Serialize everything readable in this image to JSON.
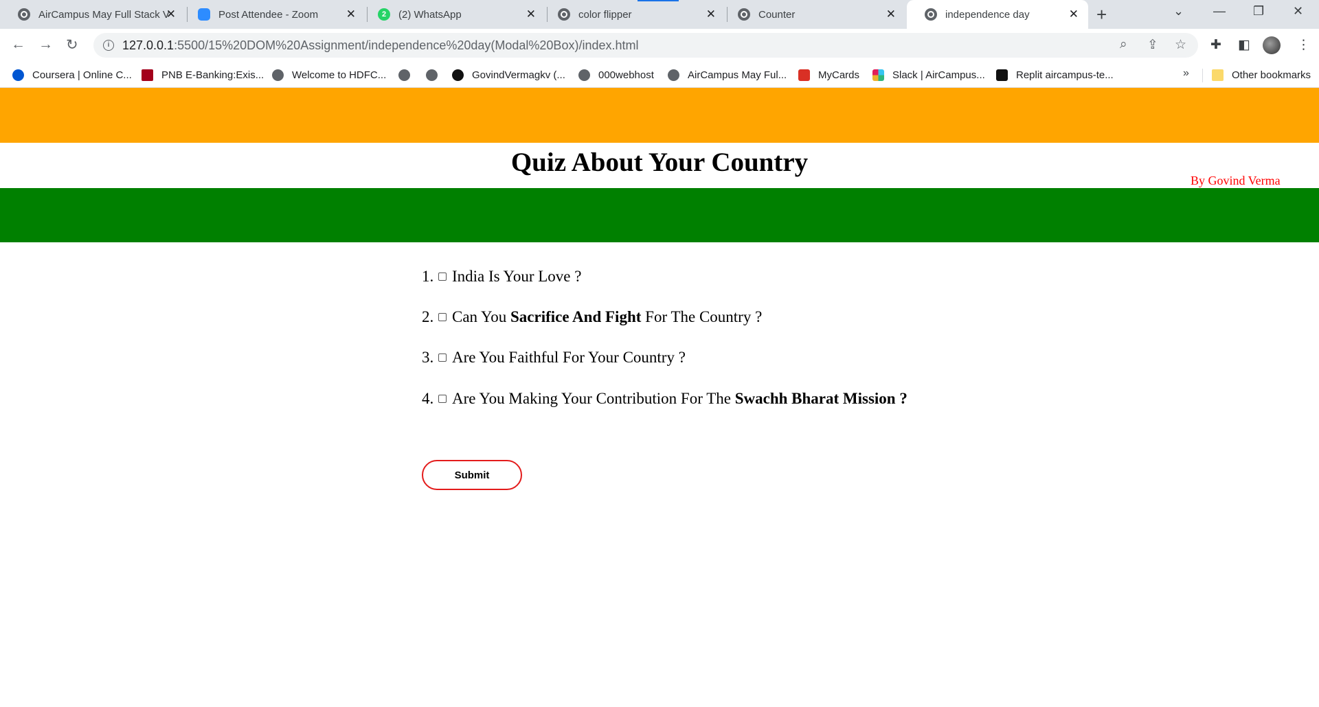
{
  "browser": {
    "tabs": [
      {
        "title": "AirCampus May Full Stack V",
        "icon": "globe-icon"
      },
      {
        "title": "Post Attendee - Zoom",
        "icon": "zoom-icon"
      },
      {
        "title": "(2) WhatsApp",
        "icon": "whatsapp-icon",
        "badge": "2"
      },
      {
        "title": "color flipper",
        "icon": "globe-icon"
      },
      {
        "title": "Counter",
        "icon": "globe-icon"
      },
      {
        "title": "independence day",
        "icon": "globe-icon",
        "active": true
      }
    ],
    "tab_close": "✕",
    "new_tab": "+",
    "url_host": "127.0.0.1",
    "url_rest": ":5500/15%20DOM%20Assignment/independence%20day(Modal%20Box)/index.html",
    "bookmarks": [
      {
        "label": "Coursera | Online C...",
        "icon": "coursera-icon"
      },
      {
        "label": "PNB E-Banking:Exis...",
        "icon": "pnb-icon"
      },
      {
        "label": "Welcome to HDFC...",
        "icon": "globe-icon"
      },
      {
        "label": "",
        "icon": "globe-icon"
      },
      {
        "label": "",
        "icon": "globe-icon"
      },
      {
        "label": "GovindVermagkv (...",
        "icon": "github-icon"
      },
      {
        "label": "000webhost",
        "icon": "globe-icon"
      },
      {
        "label": "AirCampus May Ful...",
        "icon": "globe-icon"
      },
      {
        "label": "MyCards",
        "icon": "mycards-icon"
      },
      {
        "label": "Slack | AirCampus...",
        "icon": "slack-icon"
      },
      {
        "label": "Replit aircampus-te...",
        "icon": "replit-icon"
      }
    ],
    "bookmarks_more": "»",
    "other_bookmarks": "Other bookmarks"
  },
  "page": {
    "title": "Quiz About Your Country",
    "author": "By Govind Verma",
    "questions": [
      {
        "num": "1.",
        "pre": "India Is Your Love ?",
        "bold": "",
        "post": ""
      },
      {
        "num": "2.",
        "pre": "Can You ",
        "bold": "Sacrifice And Fight",
        "post": " For The Country ?"
      },
      {
        "num": "3.",
        "pre": "Are You Faithful For Your Country ?",
        "bold": "",
        "post": ""
      },
      {
        "num": "4.",
        "pre": "Are You Making Your Contribution For The ",
        "bold": "Swachh Bharat Mission ?",
        "post": ""
      }
    ],
    "submit_label": "Submit"
  },
  "colors": {
    "saffron": "#ffa500",
    "green": "#008000",
    "author": "#ff0000",
    "submit_border": "#e31b1b"
  }
}
